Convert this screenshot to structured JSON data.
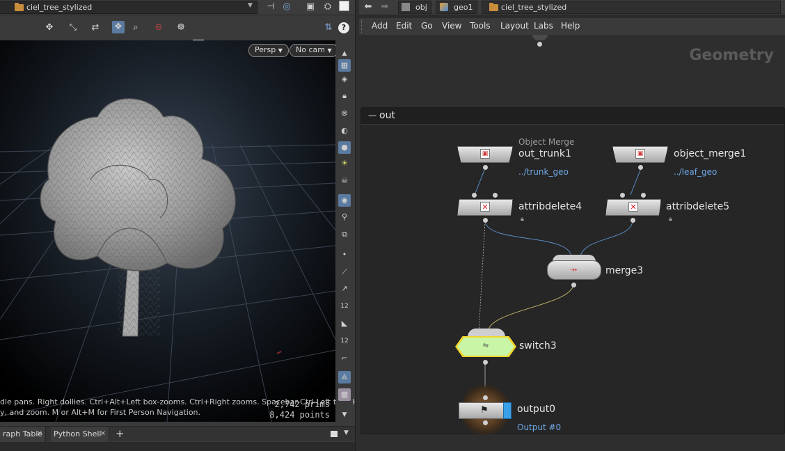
{
  "left_pane": {
    "path_name": "ciel_tree_stylized",
    "viewport": {
      "persp_label": "Persp",
      "cam_label": "No cam",
      "hint_line1": "dle pans. Right dollies. Ctrl+Alt+Left box-zooms. Ctrl+Right zooms. Spacebar-Ctrl-Left tilts. Hold L",
      "hint_line2": "y, and zoom.    M or Alt+M for First Person Navigation.",
      "prims": "2,742  prims",
      "points": "8,424 points"
    },
    "tabs": [
      {
        "label": "raph Table"
      },
      {
        "label": "Python Shell"
      }
    ],
    "add_tab": "+"
  },
  "right_pane": {
    "breadcrumbs": [
      "obj",
      "geo1",
      "ciel_tree_stylized"
    ],
    "menu": [
      "Add",
      "Edit",
      "Go",
      "View",
      "Tools",
      "Layout",
      "Labs",
      "Help"
    ],
    "context_label": "Geometry",
    "subnet_title": "out",
    "collapse_glyph": "—",
    "nodes": {
      "out_trunk1": {
        "type": "Object Merge",
        "name": "out_trunk1",
        "sub": "../trunk_geo"
      },
      "object_merge1": {
        "name": "object_merge1",
        "sub": "../leaf_geo"
      },
      "attribdelete4": {
        "name": "attribdelete4"
      },
      "attribdelete5": {
        "name": "attribdelete5"
      },
      "merge3": {
        "name": "merge3"
      },
      "switch3": {
        "name": "switch3"
      },
      "output0": {
        "name": "output0",
        "sub": "Output #0"
      }
    }
  },
  "colors": {
    "switch_fill": "#c8f5a6",
    "switch_border": "#f2d52b",
    "link_blue": "#6fa8e6",
    "output_flag": "#3aa0e8"
  }
}
